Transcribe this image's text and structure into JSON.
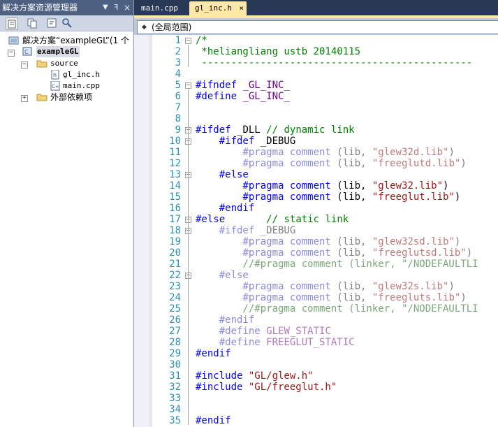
{
  "solution_explorer": {
    "title": "解决方案资源管理器",
    "pin_glyph": "▼ ᵽ ×",
    "tree": [
      {
        "label": "解决方案“exampleGL”(1 个",
        "level": 0,
        "icon": "solution-icon"
      },
      {
        "label": "exampleGL",
        "level": 1,
        "icon": "project-icon",
        "expander": "−"
      },
      {
        "label": "source",
        "level": 2,
        "icon": "folder-icon",
        "expander": "−"
      },
      {
        "label": "gl_inc.h",
        "level": 3,
        "icon": "header-file-icon"
      },
      {
        "label": "main.cpp",
        "level": 3,
        "icon": "cpp-file-icon"
      },
      {
        "label": "外部依赖项",
        "level": 2,
        "icon": "folder-icon",
        "expander": "+"
      }
    ]
  },
  "tabs": [
    {
      "label": "main.cpp",
      "active": false
    },
    {
      "label": "gl_inc.h",
      "active": true,
      "close": "×"
    }
  ],
  "scope": {
    "label": "(全局范围)"
  },
  "editor": {
    "lines": [
      {
        "n": "1",
        "parts": [
          [
            "cm",
            "/*"
          ]
        ]
      },
      {
        "n": "2",
        "parts": [
          [
            "cm",
            " *heliangliang ustb 20140115"
          ]
        ]
      },
      {
        "n": "3",
        "parts": [
          [
            "cm",
            " ----------------------------------------------"
          ]
        ]
      },
      {
        "n": "4",
        "parts": []
      },
      {
        "n": "5",
        "parts": [
          [
            "pp",
            "#ifndef "
          ],
          [
            "mac",
            "_GL_INC_"
          ]
        ]
      },
      {
        "n": "6",
        "parts": [
          [
            "pp",
            "#define "
          ],
          [
            "mac",
            "_GL_INC_"
          ]
        ]
      },
      {
        "n": "7",
        "parts": []
      },
      {
        "n": "8",
        "parts": []
      },
      {
        "n": "9",
        "parts": [
          [
            "pp",
            "#ifdef "
          ],
          [
            "plain",
            "_DLL "
          ],
          [
            "cm",
            "// dynamic link"
          ]
        ]
      },
      {
        "n": "10",
        "parts": [
          [
            "pp",
            "    #ifdef "
          ],
          [
            "plain",
            "_DEBUG"
          ]
        ]
      },
      {
        "n": "11",
        "parts": [
          [
            "pp-dim",
            "        #pragma "
          ],
          [
            "pp-dim",
            "comment "
          ],
          [
            "dim",
            "(lib, "
          ],
          [
            "st-dim",
            "\"glew32d.lib\""
          ],
          [
            "dim",
            ")"
          ]
        ]
      },
      {
        "n": "12",
        "parts": [
          [
            "pp-dim",
            "        #pragma "
          ],
          [
            "pp-dim",
            "comment "
          ],
          [
            "dim",
            "(lib, "
          ],
          [
            "st-dim",
            "\"freeglutd.lib\""
          ],
          [
            "dim",
            ")"
          ]
        ]
      },
      {
        "n": "13",
        "parts": [
          [
            "pp",
            "    #else"
          ]
        ]
      },
      {
        "n": "14",
        "parts": [
          [
            "pp",
            "        #pragma "
          ],
          [
            "kw",
            "comment "
          ],
          [
            "plain",
            "(lib, "
          ],
          [
            "st",
            "\"glew32.lib\""
          ],
          [
            "plain",
            ")"
          ]
        ]
      },
      {
        "n": "15",
        "parts": [
          [
            "pp",
            "        #pragma "
          ],
          [
            "kw",
            "comment "
          ],
          [
            "plain",
            "(lib, "
          ],
          [
            "st",
            "\"freeglut.lib\""
          ],
          [
            "plain",
            ")"
          ]
        ]
      },
      {
        "n": "16",
        "parts": [
          [
            "pp",
            "    #endif"
          ]
        ]
      },
      {
        "n": "17",
        "parts": [
          [
            "pp",
            "#else"
          ],
          [
            "plain",
            "       "
          ],
          [
            "cm",
            "// static link"
          ]
        ]
      },
      {
        "n": "18",
        "parts": [
          [
            "pp-dim",
            "    #ifdef "
          ],
          [
            "dim",
            "_DEBUG"
          ]
        ]
      },
      {
        "n": "19",
        "parts": [
          [
            "pp-dim",
            "        #pragma "
          ],
          [
            "pp-dim",
            "comment "
          ],
          [
            "dim",
            "(lib, "
          ],
          [
            "st-dim",
            "\"glew32sd.lib\""
          ],
          [
            "dim",
            ")"
          ]
        ]
      },
      {
        "n": "20",
        "parts": [
          [
            "pp-dim",
            "        #pragma "
          ],
          [
            "pp-dim",
            "comment "
          ],
          [
            "dim",
            "(lib, "
          ],
          [
            "st-dim",
            "\"freeglutsd.lib\""
          ],
          [
            "dim",
            ")"
          ]
        ]
      },
      {
        "n": "21",
        "parts": [
          [
            "cm-dim",
            "        //#pragma comment (linker, \"/NODEFAULTLI"
          ]
        ]
      },
      {
        "n": "22",
        "parts": [
          [
            "pp-dim",
            "    #else"
          ]
        ]
      },
      {
        "n": "23",
        "parts": [
          [
            "pp-dim",
            "        #pragma "
          ],
          [
            "pp-dim",
            "comment "
          ],
          [
            "dim",
            "(lib, "
          ],
          [
            "st-dim",
            "\"glew32s.lib\""
          ],
          [
            "dim",
            ")"
          ]
        ]
      },
      {
        "n": "24",
        "parts": [
          [
            "pp-dim",
            "        #pragma "
          ],
          [
            "pp-dim",
            "comment "
          ],
          [
            "dim",
            "(lib, "
          ],
          [
            "st-dim",
            "\"freegluts.lib\""
          ],
          [
            "dim",
            ")"
          ]
        ]
      },
      {
        "n": "25",
        "parts": [
          [
            "cm-dim",
            "        //#pragma comment (linker, \"/NODEFAULTLI"
          ]
        ]
      },
      {
        "n": "26",
        "parts": [
          [
            "pp-dim",
            "    #endif"
          ]
        ]
      },
      {
        "n": "27",
        "parts": [
          [
            "pp-dim",
            "    #define "
          ],
          [
            "mac-dim",
            "GLEW_STATIC"
          ]
        ]
      },
      {
        "n": "28",
        "parts": [
          [
            "pp-dim",
            "    #define "
          ],
          [
            "mac-dim",
            "FREEGLUT_STATIC"
          ]
        ]
      },
      {
        "n": "29",
        "parts": [
          [
            "pp",
            "#endif"
          ]
        ]
      },
      {
        "n": "30",
        "parts": []
      },
      {
        "n": "31",
        "parts": [
          [
            "pp",
            "#include "
          ],
          [
            "st",
            "\"GL/glew.h\""
          ]
        ]
      },
      {
        "n": "32",
        "parts": [
          [
            "pp",
            "#include "
          ],
          [
            "st",
            "\"GL/freeglut.h\""
          ]
        ]
      },
      {
        "n": "33",
        "parts": []
      },
      {
        "n": "34",
        "parts": []
      },
      {
        "n": "35",
        "parts": [
          [
            "pp",
            "#endif"
          ]
        ]
      }
    ]
  }
}
